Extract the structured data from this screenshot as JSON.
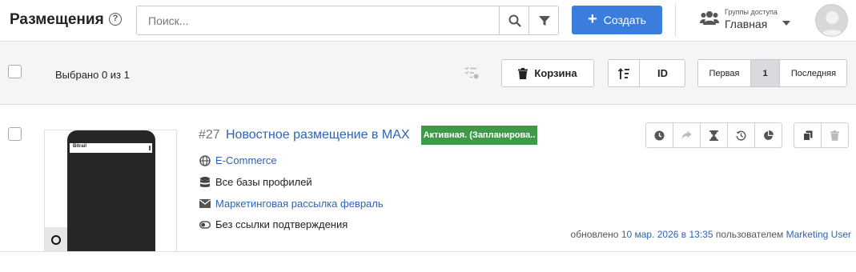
{
  "header": {
    "title": "Размещения",
    "help_icon": "?",
    "search_placeholder": "Поиск...",
    "create_label": "Создать",
    "group_label": "Группы доступа",
    "group_value": "Главная"
  },
  "toolbar": {
    "selected_text": "Выбрано 0 из 1",
    "trash_label": "Корзина",
    "sort_id_label": "ID",
    "pager": {
      "first": "Первая",
      "current": "1",
      "last": "Последняя"
    }
  },
  "row": {
    "number": "#27",
    "title": "Новостное размещение в MAX",
    "status_badge": "Активная. (Запланирова..",
    "category": "E-Commerce",
    "database": "Все базы профилей",
    "mailing": "Маркетинговая рассылка февраль",
    "confirm": "Без ссылки подтверждения",
    "updated_prefix": "обновлено",
    "updated_date": "10 мар. 2026 в 13:35",
    "updated_by_prefix": "пользователем",
    "updated_user": "Marketing User",
    "preview_header": "Bitrail"
  },
  "colors": {
    "accent": "#3b7ddd",
    "link": "#2f64b2",
    "status_active": "#3e9a49"
  },
  "icons": {
    "search": "search-icon",
    "filter": "filter-icon",
    "users": "users-icon",
    "trash": "trash-icon",
    "sort": "sort-icon",
    "globe": "globe-icon",
    "database": "database-icon",
    "envelope": "envelope-icon",
    "toggle": "toggle-icon"
  }
}
